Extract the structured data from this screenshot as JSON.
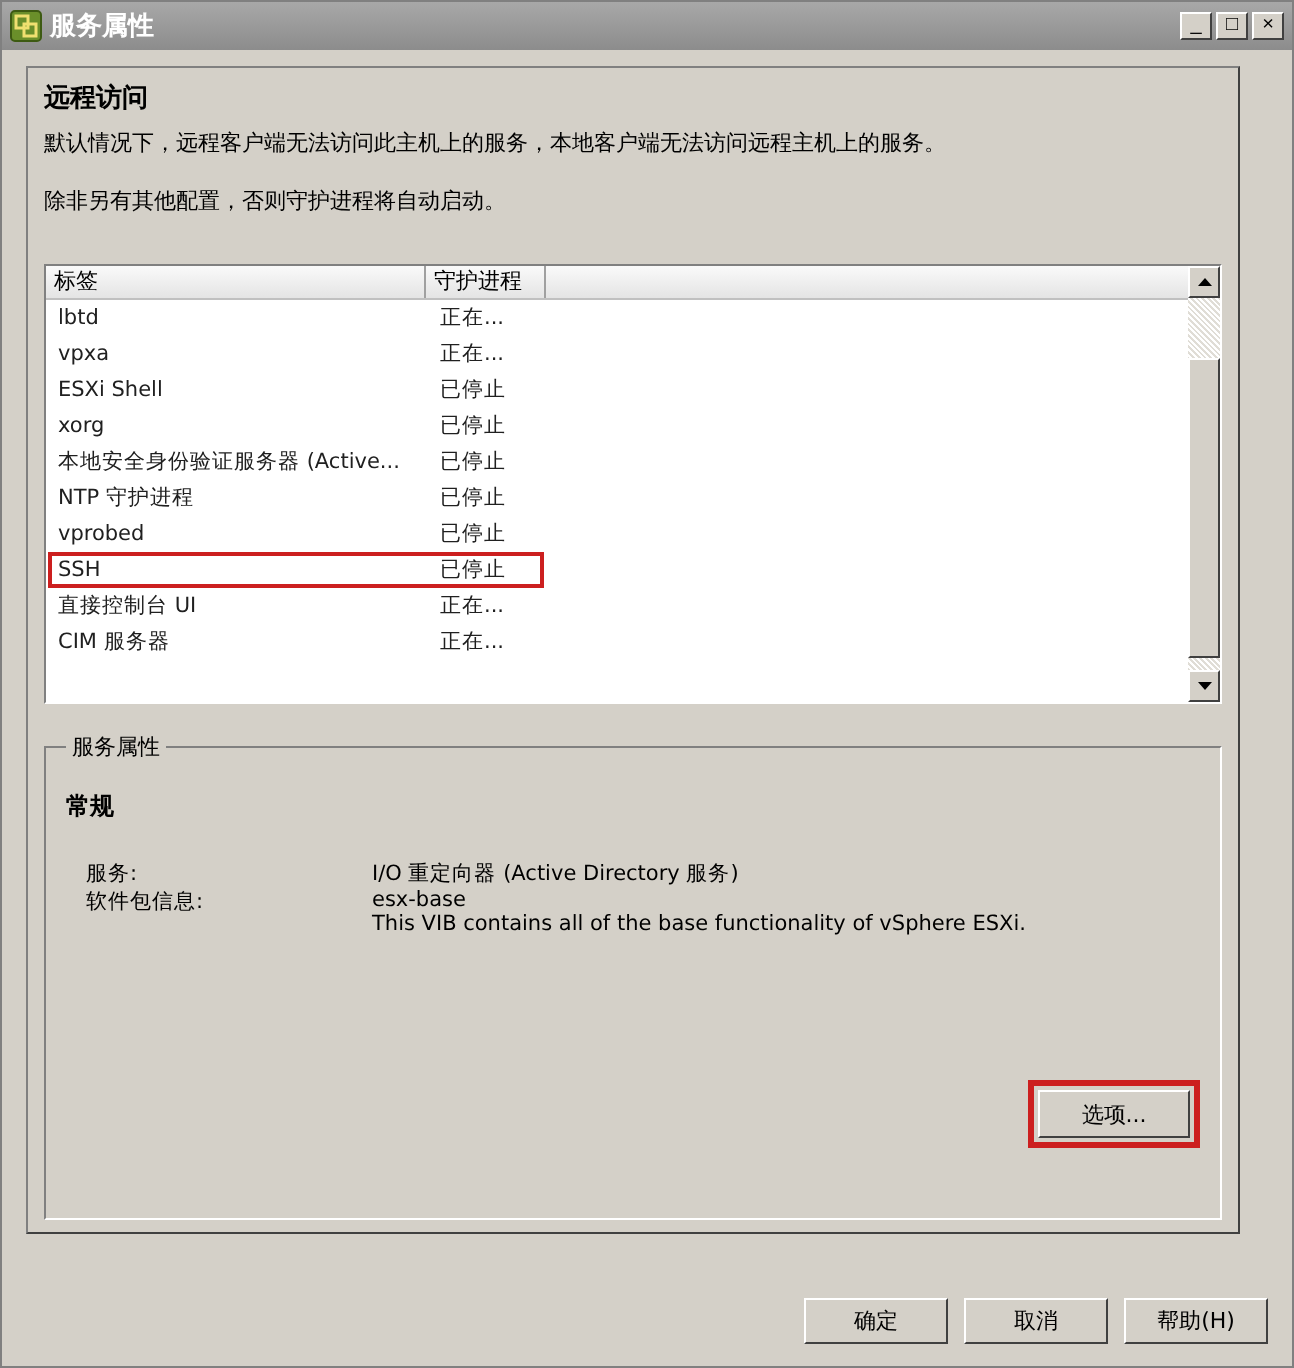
{
  "window": {
    "title": "服务属性",
    "controls": [
      "_",
      "□",
      "×"
    ]
  },
  "intro": {
    "heading": "远程访问",
    "paragraphs": [
      "默认情况下，远程客户端无法访问此主机上的服务，本地客户端无法访问远程主机上的服务。",
      "除非另有其他配置，否则守护进程将自动启动。"
    ]
  },
  "table": {
    "columns": [
      "标签",
      "守护进程"
    ],
    "rows": [
      {
        "label": "lbtd",
        "daemon": "正在...",
        "highlighted": false
      },
      {
        "label": "vpxa",
        "daemon": "正在...",
        "highlighted": false
      },
      {
        "label": "ESXi Shell",
        "daemon": "已停止",
        "highlighted": false
      },
      {
        "label": "xorg",
        "daemon": "已停止",
        "highlighted": false
      },
      {
        "label": "本地安全身份验证服务器 (Active...",
        "daemon": "已停止",
        "highlighted": false
      },
      {
        "label": "NTP 守护进程",
        "daemon": "已停止",
        "highlighted": false
      },
      {
        "label": "vprobed",
        "daemon": "已停止",
        "highlighted": false
      },
      {
        "label": "SSH",
        "daemon": "已停止",
        "highlighted": true
      },
      {
        "label": "直接控制台 UI",
        "daemon": "正在...",
        "highlighted": false
      },
      {
        "label": "CIM 服务器",
        "daemon": "正在...",
        "highlighted": false
      }
    ]
  },
  "properties": {
    "legend": "服务属性",
    "heading": "常规",
    "fields": [
      {
        "label": "服务:",
        "lines": [
          "I/O 重定向器 (Active Directory 服务)"
        ]
      },
      {
        "label": "软件包信息:",
        "lines": [
          "esx-base",
          "This VIB contains all of the base functionality of vSphere ESXi."
        ]
      }
    ],
    "options_button": {
      "label": "选项...",
      "highlighted": true
    }
  },
  "buttons": [
    "确定",
    "取消",
    "帮助(H)"
  ]
}
